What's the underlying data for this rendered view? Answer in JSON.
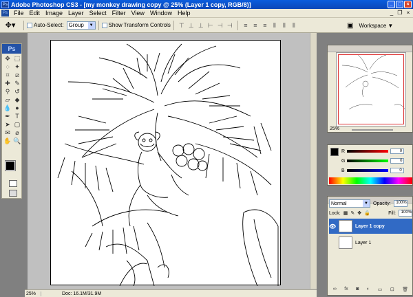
{
  "window": {
    "title": "Adobe Photoshop CS3 - [my monkey drawing copy @ 25% (Layer 1 copy, RGB/8)]"
  },
  "menu": [
    "File",
    "Edit",
    "Image",
    "Layer",
    "Select",
    "Filter",
    "View",
    "Window",
    "Help"
  ],
  "options": {
    "auto_select_label": "Auto-Select:",
    "auto_select_value": "Group",
    "show_transform_label": "Show Transform Controls",
    "workspace_label": "Workspace"
  },
  "status": {
    "zoom": "25%",
    "doc": "Doc: 16.1M/31.9M"
  },
  "navigator": {
    "zoom": "25%"
  },
  "color": {
    "r": "0",
    "g": "0",
    "b": "0",
    "r_label": "R",
    "g_label": "G",
    "b_label": "B"
  },
  "layers": {
    "blend_mode": "Normal",
    "opacity_label": "Opacity:",
    "opacity_value": "100%",
    "lock_label": "Lock:",
    "fill_label": "Fill:",
    "fill_value": "100%",
    "items": [
      {
        "name": "Layer 1 copy"
      },
      {
        "name": "Layer 1"
      }
    ]
  },
  "colors": {
    "titlebar": "#0b54c9",
    "selection": "#316ac5"
  }
}
